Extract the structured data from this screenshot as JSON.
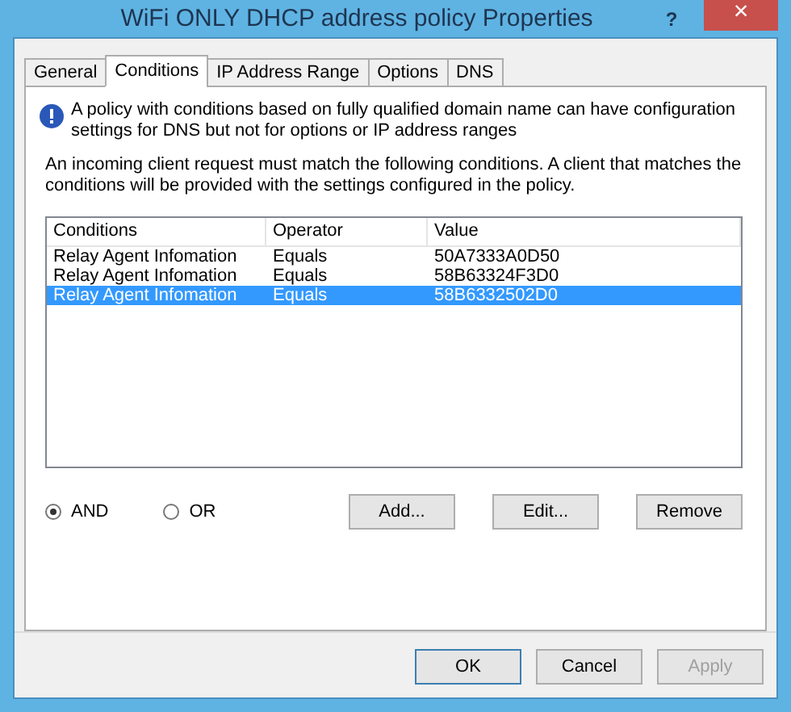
{
  "window": {
    "title": "WiFi ONLY DHCP address policy Properties",
    "help": "?",
    "close": "×"
  },
  "tabs": [
    {
      "label": "General",
      "selected": false
    },
    {
      "label": "Conditions",
      "selected": true
    },
    {
      "label": "IP Address Range",
      "selected": false
    },
    {
      "label": "Options",
      "selected": false
    },
    {
      "label": "DNS",
      "selected": false
    }
  ],
  "info": "A policy with conditions based on fully qualified domain name can have configuration settings for DNS but not for options or IP address ranges",
  "description": "An incoming client request must match the following conditions. A client that matches the conditions will be provided with the settings configured in the policy.",
  "table": {
    "columns": [
      "Conditions",
      "Operator",
      "Value"
    ],
    "rows": [
      {
        "cells": [
          "Relay Agent Infomation",
          "Equals",
          "50A7333A0D50"
        ],
        "selected": false
      },
      {
        "cells": [
          "Relay Agent Infomation",
          "Equals",
          "58B63324F3D0"
        ],
        "selected": false
      },
      {
        "cells": [
          "Relay Agent Infomation",
          "Equals",
          "58B6332502D0"
        ],
        "selected": true
      }
    ]
  },
  "logic": [
    {
      "label": "AND",
      "selected": true
    },
    {
      "label": "OR",
      "selected": false
    }
  ],
  "condition_buttons": [
    "Add...",
    "Edit...",
    "Remove"
  ],
  "dialog_buttons": [
    {
      "label": "OK",
      "disabled": false,
      "default": true
    },
    {
      "label": "Cancel",
      "disabled": false,
      "default": false
    },
    {
      "label": "Apply",
      "disabled": true,
      "default": false
    }
  ]
}
